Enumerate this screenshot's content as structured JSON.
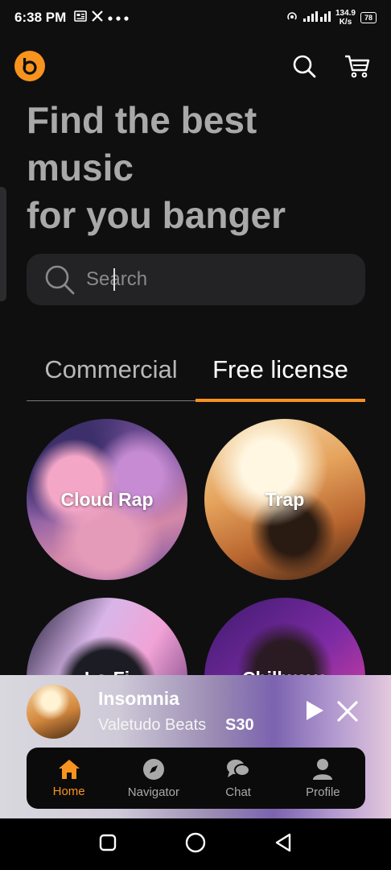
{
  "status_bar": {
    "time": "6:38 PM",
    "network_speed": "134.9",
    "network_unit": "K/s",
    "battery": "78"
  },
  "header": {
    "logo": "b",
    "search_icon": "search-icon",
    "cart_icon": "cart-icon"
  },
  "headline": {
    "line1": "Find the best",
    "line2": "music",
    "line3": "for you banger"
  },
  "search": {
    "placeholder": "Search"
  },
  "tabs": [
    {
      "label": "Commercial",
      "active": false
    },
    {
      "label": "Free license",
      "active": true
    }
  ],
  "genres": [
    {
      "label": "Cloud Rap"
    },
    {
      "label": "Trap"
    },
    {
      "label": "Lo-Fi"
    },
    {
      "label": "Chillwave"
    }
  ],
  "player": {
    "title": "Insomnia",
    "artist": "Valetudo Beats",
    "price": "S30"
  },
  "bottom_nav": [
    {
      "label": "Home",
      "icon": "home-icon",
      "active": true
    },
    {
      "label": "Navigator",
      "icon": "compass-icon",
      "active": false
    },
    {
      "label": "Chat",
      "icon": "chat-icon",
      "active": false
    },
    {
      "label": "Profile",
      "icon": "profile-icon",
      "active": false
    }
  ],
  "colors": {
    "accent": "#f7931e",
    "background": "#0f0f10"
  }
}
